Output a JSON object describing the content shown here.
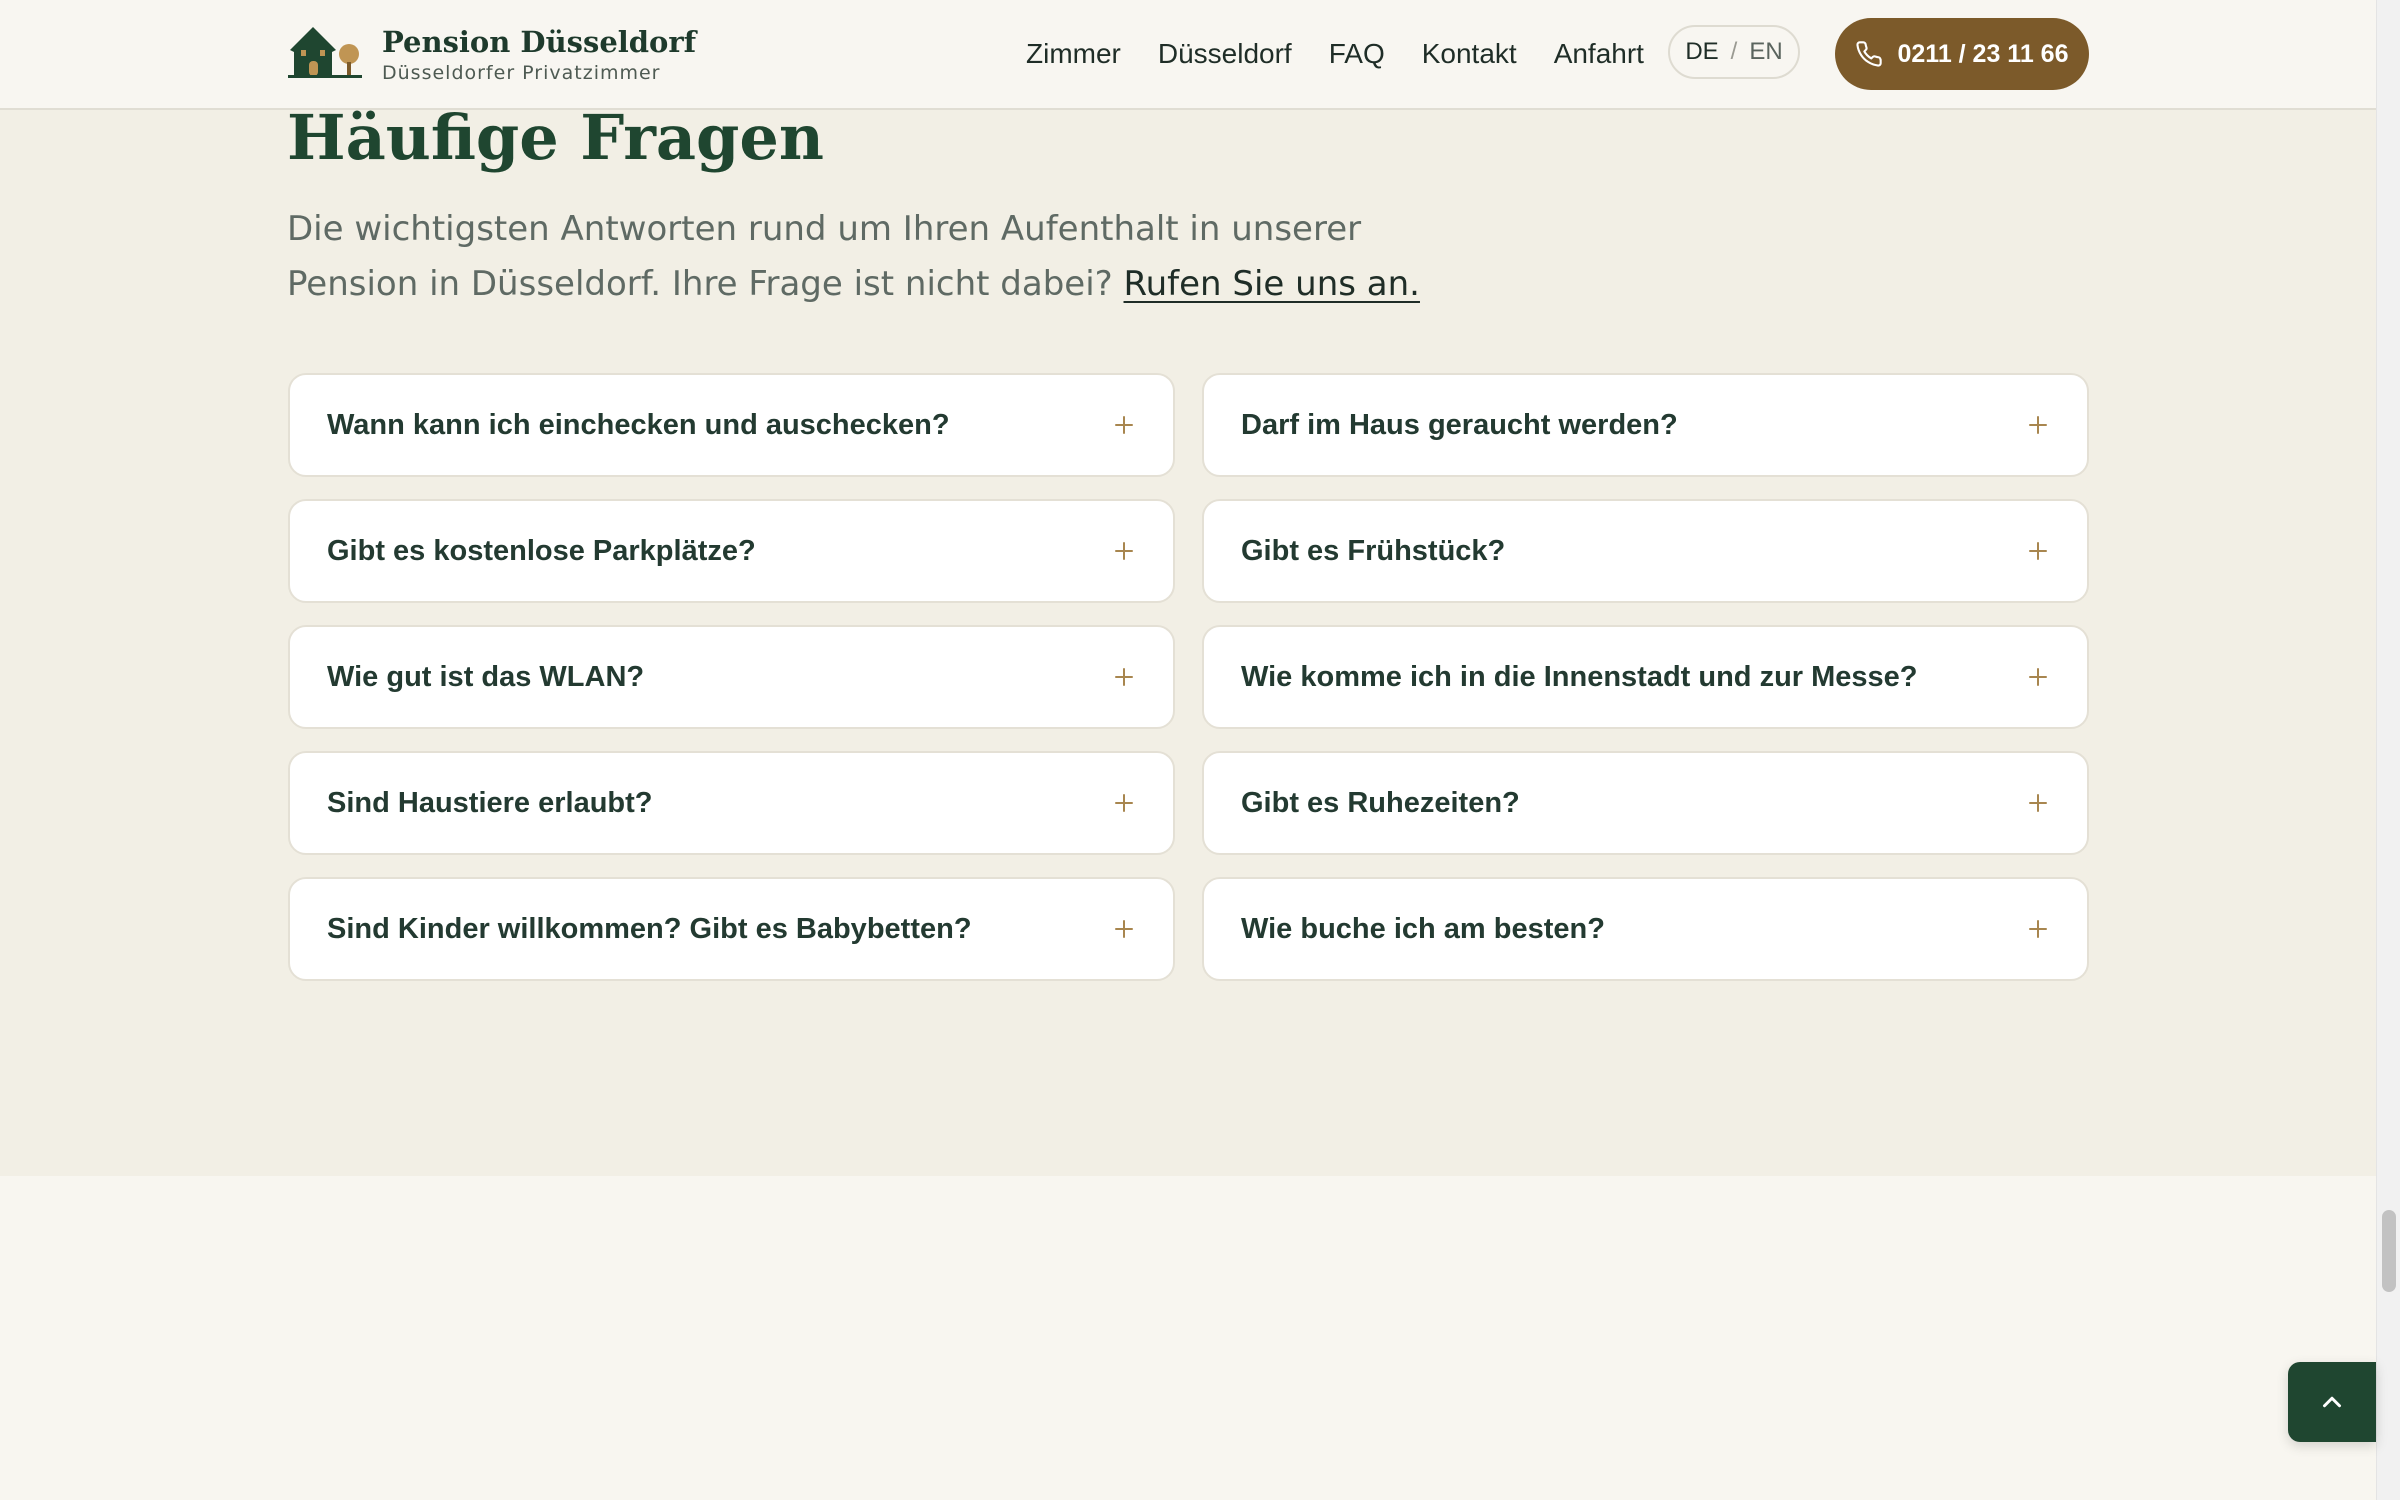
{
  "header": {
    "brand_name": "Pension Düsseldorf",
    "brand_tagline": "Düsseldorfer Privatzimmer",
    "nav": [
      {
        "label": "Zimmer"
      },
      {
        "label": "Düsseldorf"
      },
      {
        "label": "FAQ"
      },
      {
        "label": "Kontakt"
      },
      {
        "label": "Anfahrt"
      }
    ],
    "language": {
      "de": "DE",
      "separator": "/",
      "en": "EN"
    },
    "phone_label": "0211 / 23 11 66"
  },
  "faq": {
    "title": "Häufige Fragen",
    "intro_text": "Die wichtigsten Antworten rund um Ihren Aufenthalt in unserer Pension in Düsseldorf. Ihre Frage ist nicht dabei? ",
    "intro_link": "Rufen Sie uns an.",
    "questions": [
      "Wann kann ich einchecken und auschecken?",
      "Darf im Haus geraucht werden?",
      "Gibt es kostenlose Parkplätze?",
      "Gibt es Frühstück?",
      "Wie gut ist das WLAN?",
      "Wie komme ich in die Innenstadt und zur Messe?",
      "Sind Haustiere erlaubt?",
      "Gibt es Ruhezeiten?",
      "Sind Kinder willkommen? Gibt es Babybetten?",
      "Wie buche ich am besten?"
    ]
  },
  "icons": {
    "logo": "house-tree-logo",
    "phone": "phone-icon",
    "toggle": "plus-icon",
    "back_to_top": "chevron-up-icon"
  },
  "colors": {
    "primary_green": "#1f4630",
    "accent_brown": "#7c5a2a",
    "section_background": "#f2efe5",
    "page_background": "#f8f6f0",
    "card_background": "#ffffff",
    "plus_color": "#a8864f"
  }
}
